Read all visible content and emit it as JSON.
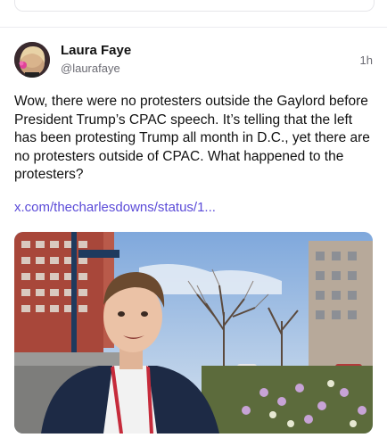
{
  "post": {
    "author_name": "Laura Faye",
    "author_handle": "@laurafaye",
    "timestamp": "1h",
    "text": "Wow, there were no protesters outside the Gaylord before President Trump’s CPAC speech. It’s telling that the left has been protesting Trump all month in D.C., yet there are no protesters outside of CPAC. What happened to the protesters?",
    "link": "x.com/thecharlesdowns/status/1...",
    "media_description_icon": "video-thumbnail"
  },
  "colors": {
    "link": "#5b4bd8",
    "muted": "#6b6b73",
    "divider": "#ececf0"
  }
}
